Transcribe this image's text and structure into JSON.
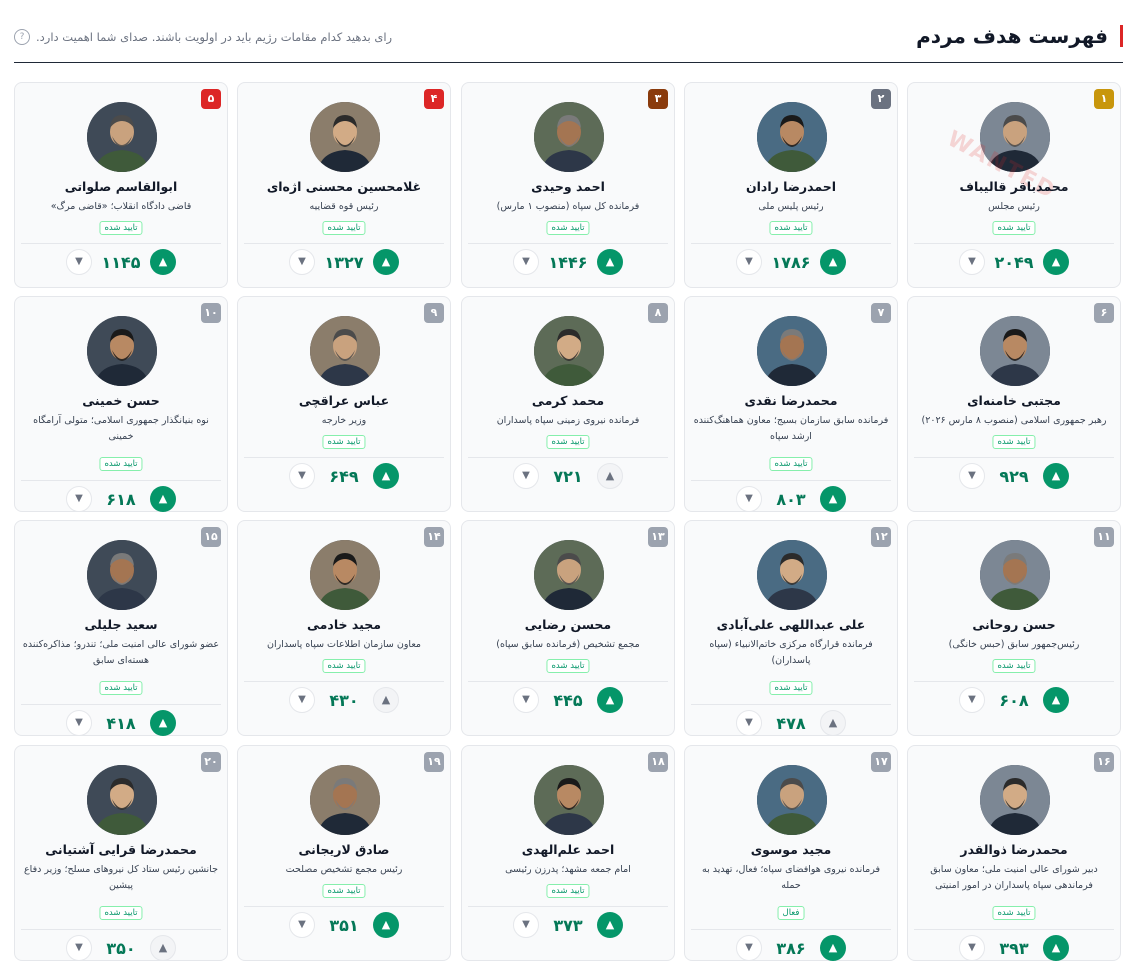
{
  "header": {
    "title": "فهرست هدف مردم",
    "subtitle": "رای بدهید کدام مقامات رژیم باید در اولویت باشند. صدای شما اهمیت دارد.",
    "help_icon": "?"
  },
  "colors": {
    "gold": "#c8960c",
    "silver": "#6b7280",
    "bronze": "#8a3b0c",
    "red": "#dc2626",
    "gray": "#9ca3af",
    "green": "#059669"
  },
  "watermark": "WANTED",
  "cards": [
    {
      "rank": "۱",
      "name": "محمدباقر قالیباف",
      "role": "رئیس مجلس",
      "status": "تایید شده",
      "score": "۲۰۴۹",
      "up": "▲",
      "down": "▼"
    },
    {
      "rank": "۲",
      "name": "احمدرضا رادان",
      "role": "رئیس پلیس ملی",
      "status": "تایید شده",
      "score": "۱۷۸۶",
      "up": "▲",
      "down": "▼"
    },
    {
      "rank": "۳",
      "name": "احمد وحیدی",
      "role": "فرمانده کل سپاه (منصوب ۱ مارس)",
      "status": "تایید شده",
      "score": "۱۴۴۶",
      "up": "▲",
      "down": "▼"
    },
    {
      "rank": "۴",
      "name": "غلامحسین محسنی اژه‌ای",
      "role": "رئیس قوه قضاییه",
      "status": "تایید شده",
      "score": "۱۳۲۷",
      "up": "▲",
      "down": "▼"
    },
    {
      "rank": "۵",
      "name": "ابوالقاسم صلواتی",
      "role": "قاضی دادگاه انقلاب؛ «قاضی مرگ»",
      "status": "تایید شده",
      "score": "۱۱۴۵",
      "up": "▲",
      "down": "▼"
    },
    {
      "rank": "۶",
      "name": "مجتبی خامنه‌ای",
      "role": "رهبر جمهوری اسلامی (منصوب ۸ مارس ۲۰۲۶)",
      "status": "تایید شده",
      "score": "۹۲۹",
      "up": "▲",
      "down": "▼"
    },
    {
      "rank": "۷",
      "name": "محمدرضا نقدی",
      "role": "فرمانده سابق سازمان بسیج؛ معاون هماهنگ‌کننده ارشد سپاه",
      "status": "تایید شده",
      "score": "۸۰۳",
      "up": "▲",
      "down": "▼"
    },
    {
      "rank": "۸",
      "name": "محمد کرمی",
      "role": "فرمانده نیروی زمینی سپاه پاسداران",
      "status": "تایید شده",
      "score": "۷۲۱",
      "up": "▲",
      "down": "▼"
    },
    {
      "rank": "۹",
      "name": "عباس عراقچی",
      "role": "وزیر خارجه",
      "status": "تایید شده",
      "score": "۶۴۹",
      "up": "▲",
      "down": "▼"
    },
    {
      "rank": "۱۰",
      "name": "حسن خمینی",
      "role": "نوه بنیانگذار جمهوری اسلامی؛ متولی آرامگاه خمینی",
      "status": "تایید شده",
      "score": "۶۱۸",
      "up": "▲",
      "down": "▼"
    },
    {
      "rank": "۱۱",
      "name": "حسن روحانی",
      "role": "رئیس‌جمهور سابق (حبس خانگی)",
      "status": "تایید شده",
      "score": "۶۰۸",
      "up": "▲",
      "down": "▼"
    },
    {
      "rank": "۱۲",
      "name": "علی عبداللهی علی‌آبادی",
      "role": "فرمانده قرارگاه مرکزی خاتم‌الانبیاء (سپاه پاسداران)",
      "status": "تایید شده",
      "score": "۴۷۸",
      "up": "▲",
      "down": "▼"
    },
    {
      "rank": "۱۳",
      "name": "محسن رضایی",
      "role": "مجمع تشخیص (فرمانده سابق سپاه)",
      "status": "تایید شده",
      "score": "۴۴۵",
      "up": "▲",
      "down": "▼"
    },
    {
      "rank": "۱۴",
      "name": "مجید خادمی",
      "role": "معاون سازمان اطلاعات سپاه پاسداران",
      "status": "تایید شده",
      "score": "۴۳۰",
      "up": "▲",
      "down": "▼"
    },
    {
      "rank": "۱۵",
      "name": "سعید جلیلی",
      "role": "عضو شورای عالی امنیت ملی؛ تندرو؛ مذاکره‌کننده هسته‌ای سابق",
      "status": "تایید شده",
      "score": "۴۱۸",
      "up": "▲",
      "down": "▼"
    },
    {
      "rank": "۱۶",
      "name": "محمدرضا ذوالقدر",
      "role": "دبیر شورای عالی امنیت ملی؛ معاون سابق فرماندهی سپاه پاسداران در امور امنیتی",
      "status": "تایید شده",
      "score": "۳۹۳",
      "up": "▲",
      "down": "▼"
    },
    {
      "rank": "۱۷",
      "name": "مجید موسوی",
      "role": "فرمانده نیروی هوافضای سپاه؛ فعال، تهدید به حمله",
      "status": "فعال",
      "score": "۳۸۶",
      "up": "▲",
      "down": "▼"
    },
    {
      "rank": "۱۸",
      "name": "احمد علم‌الهدی",
      "role": "امام جمعه مشهد؛ پدرزن رئیسی",
      "status": "تایید شده",
      "score": "۳۷۳",
      "up": "▲",
      "down": "▼"
    },
    {
      "rank": "۱۹",
      "name": "صادق لاریجانی",
      "role": "رئیس مجمع تشخیص مصلحت",
      "status": "تایید شده",
      "score": "۳۵۱",
      "up": "▲",
      "down": "▼"
    },
    {
      "rank": "۲۰",
      "name": "محمدرضا قرایی آشتیانی",
      "role": "جانشین رئیس ستاد کل نیروهای مسلح؛ وزیر دفاع پیشین",
      "status": "تایید شده",
      "score": "۳۵۰",
      "up": "▲",
      "down": "▼"
    }
  ]
}
